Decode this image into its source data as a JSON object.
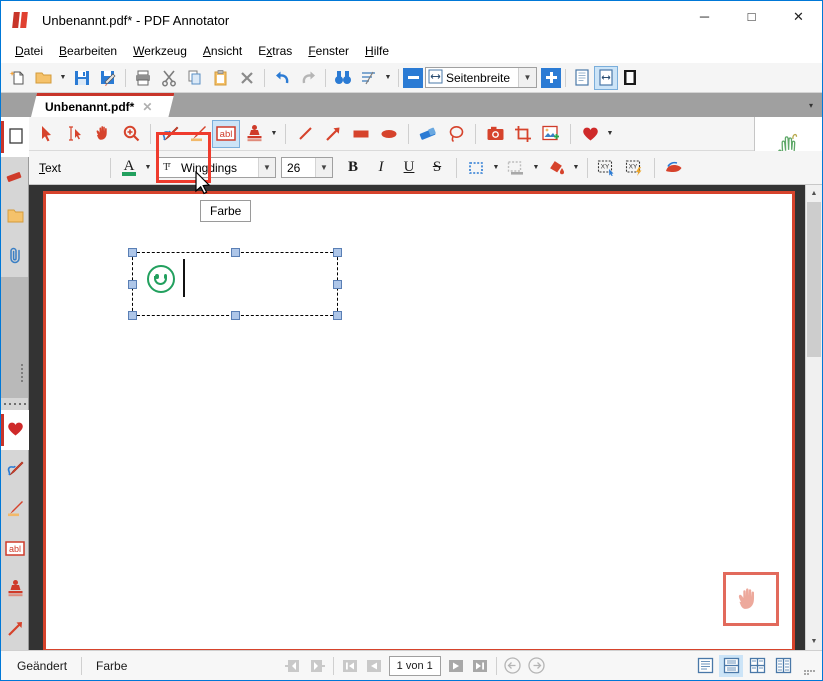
{
  "window": {
    "title": "Unbenannt.pdf* - PDF Annotator",
    "app_icon": "pdf-annotator-logo-icon",
    "minimize_label": "─",
    "maximize_label": "□",
    "close_label": "✕"
  },
  "menu": {
    "items": [
      {
        "label": "Datei",
        "accel": "D"
      },
      {
        "label": "Bearbeiten",
        "accel": "B"
      },
      {
        "label": "Werkzeug",
        "accel": "W"
      },
      {
        "label": "Ansicht",
        "accel": "A"
      },
      {
        "label": "Extras",
        "accel": "x"
      },
      {
        "label": "Fenster",
        "accel": "F"
      },
      {
        "label": "Hilfe",
        "accel": "H"
      }
    ]
  },
  "main_toolbar": {
    "buttons": [
      {
        "name": "new-document-button",
        "icon": "new-page-icon"
      },
      {
        "name": "open-document-button",
        "icon": "open-folder-icon"
      },
      {
        "name": "open-dropdown-button",
        "icon": "chevron-down-icon"
      },
      {
        "name": "save-button",
        "icon": "floppy-disk-icon"
      },
      {
        "name": "save-as-button",
        "icon": "floppy-disk-pen-icon"
      },
      {
        "name": "print-button",
        "icon": "printer-icon"
      },
      {
        "name": "cut-button",
        "icon": "scissors-icon"
      },
      {
        "name": "copy-button",
        "icon": "copy-icon"
      },
      {
        "name": "paste-button",
        "icon": "clipboard-icon"
      },
      {
        "name": "delete-button",
        "icon": "x-cross-icon"
      },
      {
        "name": "undo-button",
        "icon": "undo-arrow-icon"
      },
      {
        "name": "redo-button",
        "icon": "redo-arrow-icon"
      },
      {
        "name": "find-button",
        "icon": "binoculars-icon"
      },
      {
        "name": "sort-filter-button",
        "icon": "bars-sort-icon"
      },
      {
        "name": "sort-filter-dropdown",
        "icon": "chevron-down-icon"
      }
    ],
    "zoom_out_label": "─",
    "zoom_in_label": "+",
    "zoom_value": "Seitenbreite",
    "zoom_icon": "fit-width-icon",
    "view_single_page": "single-page-icon",
    "view_fit_width": "fit-width-page-icon",
    "view_full_page": "full-page-icon"
  },
  "document_tab": {
    "label": "Unbenannt.pdf*",
    "close_label": "✕",
    "overflow_label": "▾"
  },
  "sidebar": {
    "items": [
      {
        "name": "sidebar-item-pages",
        "icon": "page-thumbnail-icon",
        "selected": true
      },
      {
        "name": "sidebar-item-bookmarks",
        "icon": "red-eraser-icon",
        "selected": false
      },
      {
        "name": "sidebar-item-folder",
        "icon": "yellow-folder-icon",
        "selected": false
      },
      {
        "name": "sidebar-item-attachments",
        "icon": "paperclip-icon",
        "selected": false
      }
    ],
    "favorites": [
      {
        "name": "sidebar-favorite-heart",
        "icon": "red-heart-icon",
        "selected": true
      },
      {
        "name": "sidebar-favorite-blue-pen",
        "icon": "blue-pen-icon",
        "selected": false
      },
      {
        "name": "sidebar-favorite-highlighter",
        "icon": "highlighter-pen-icon",
        "selected": false
      },
      {
        "name": "sidebar-favorite-textbox",
        "icon": "abl-textbox-icon",
        "selected": false
      },
      {
        "name": "sidebar-favorite-stamp",
        "icon": "stamp-icon",
        "selected": false
      },
      {
        "name": "sidebar-favorite-arrow",
        "icon": "red-arrow-icon",
        "selected": false
      }
    ]
  },
  "tools_toolbar": {
    "tools": [
      {
        "name": "tool-select-arrow",
        "icon": "cursor-arrow-icon",
        "active": false
      },
      {
        "name": "tool-text-select",
        "icon": "text-select-icon",
        "active": false
      },
      {
        "name": "tool-hand-pan",
        "icon": "hand-icon",
        "active": false
      },
      {
        "name": "tool-zoom",
        "icon": "magnifier-plus-icon",
        "active": false
      },
      {
        "name": "tool-pen-blue",
        "icon": "blue-pen-icon",
        "active": false
      },
      {
        "name": "tool-highlighter",
        "icon": "highlighter-pen-icon",
        "active": false
      },
      {
        "name": "tool-textbox",
        "icon": "abl-textbox-icon",
        "active": true
      },
      {
        "name": "tool-stamp",
        "icon": "stamp-icon",
        "active": false
      },
      {
        "name": "tool-stamp-dropdown",
        "icon": "chevron-down-icon",
        "active": false
      },
      {
        "name": "tool-line",
        "icon": "line-icon",
        "active": false
      },
      {
        "name": "tool-arrow",
        "icon": "arrow-icon",
        "active": false
      },
      {
        "name": "tool-rectangle",
        "icon": "filled-rectangle-icon",
        "active": false
      },
      {
        "name": "tool-ellipse",
        "icon": "filled-ellipse-icon",
        "active": false
      },
      {
        "name": "tool-eraser",
        "icon": "blue-eraser-icon",
        "active": false
      },
      {
        "name": "tool-lasso",
        "icon": "lasso-icon",
        "active": false
      },
      {
        "name": "tool-snapshot",
        "icon": "camera-icon",
        "active": false
      },
      {
        "name": "tool-crop",
        "icon": "crop-icon",
        "active": false
      },
      {
        "name": "tool-insert-image",
        "icon": "image-plus-icon",
        "active": false
      },
      {
        "name": "tool-favorites-heart",
        "icon": "red-heart-icon",
        "active": false
      },
      {
        "name": "tool-favorites-dropdown",
        "icon": "chevron-down-icon",
        "active": false
      }
    ],
    "hand_panel_icon": "hand-gesture-icon"
  },
  "format_toolbar": {
    "section_label": "Text",
    "section_accel": "T",
    "color_button": {
      "name": "font-color-button",
      "glyph": "A",
      "color": "#22a05e"
    },
    "color_dropdown_label": "▾",
    "font_icon": "font-typeface-icon",
    "font_name": "Wingdings",
    "font_size": "26",
    "bold_label": "B",
    "italic_label": "I",
    "underline_label": "U",
    "strike_label": "S",
    "border_button": "border-style-icon",
    "shadow_button": "shadow-style-icon",
    "fill_button": "fill-color-icon",
    "replace_button": "xy-replace-icon",
    "autofill_button": "xy-lightning-icon",
    "clear_button": "red-hand-sweep-icon",
    "tooltip": "Farbe"
  },
  "canvas": {
    "textbox": {
      "name": "selected-text-annotation",
      "content_glyph": "smiley-face-wingdings-glyph",
      "glyph_color": "#22a05e",
      "caret": true,
      "handles": 8
    },
    "hand_annotation": {
      "name": "hand-cursor-annotation",
      "icon": "pointing-hand-icon",
      "border_color": "#e26a5c"
    },
    "page_border_color": "#d6432c"
  },
  "scrollbar": {
    "up_label": "▲",
    "down_label": "▼"
  },
  "statusbar": {
    "modified_label": "Geändert",
    "tool_label": "Farbe",
    "prev_view_icon": "back-page-icon",
    "next_view_icon": "forward-page-icon",
    "first_page_icon": "first-page-icon",
    "prev_page_icon": "prev-page-icon",
    "page_indicator": "1 von 1",
    "next_page_icon": "next-page-icon",
    "last_page_icon": "last-page-icon",
    "back_icon": "circle-back-arrow-icon",
    "forward_icon": "circle-forward-arrow-icon",
    "view_modes": [
      {
        "name": "view-mode-single",
        "icon": "single-column-icon",
        "active": false
      },
      {
        "name": "view-mode-continuous",
        "icon": "continuous-icon",
        "active": true
      },
      {
        "name": "view-mode-facing",
        "icon": "facing-pages-icon",
        "active": false
      },
      {
        "name": "view-mode-grid",
        "icon": "grid-pages-icon",
        "active": false
      }
    ]
  }
}
